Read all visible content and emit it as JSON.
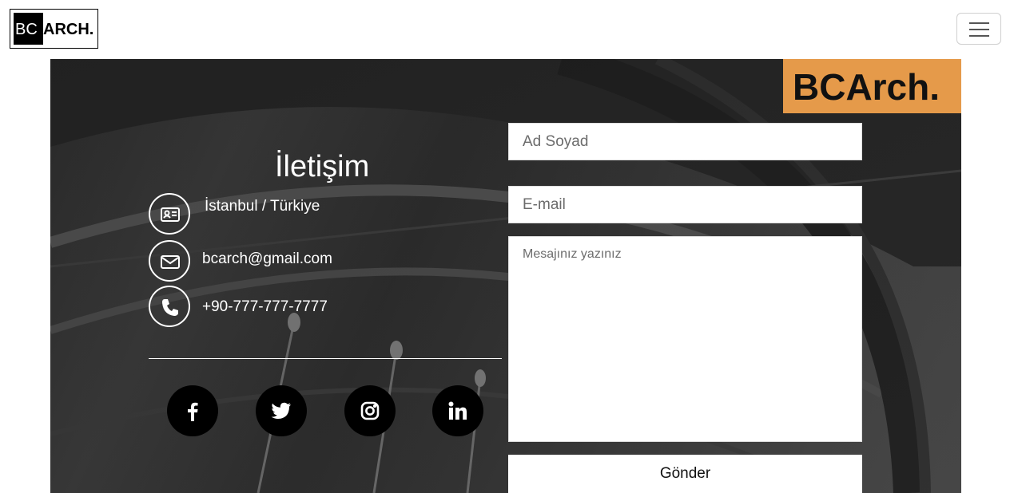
{
  "navbar": {
    "logo_bc": "BC",
    "logo_arch": "ARCH.",
    "menu_icon": "hamburger-icon"
  },
  "hero": {
    "brand_badge": "BCArch.",
    "brand_color": "#e59a4a"
  },
  "contact": {
    "title": "İletişim",
    "address": "İstanbul / Türkiye",
    "email": "bcarch@gmail.com",
    "phone": "+90-777-777-7777",
    "icons": [
      "id-card-icon",
      "envelope-icon",
      "phone-icon"
    ]
  },
  "social": [
    "facebook-icon",
    "twitter-icon",
    "instagram-icon",
    "linkedin-icon"
  ],
  "form": {
    "name_placeholder": "Ad Soyad",
    "email_placeholder": "E-mail",
    "message_placeholder": "Mesajınız yazınız",
    "submit_label": "Gönder"
  }
}
